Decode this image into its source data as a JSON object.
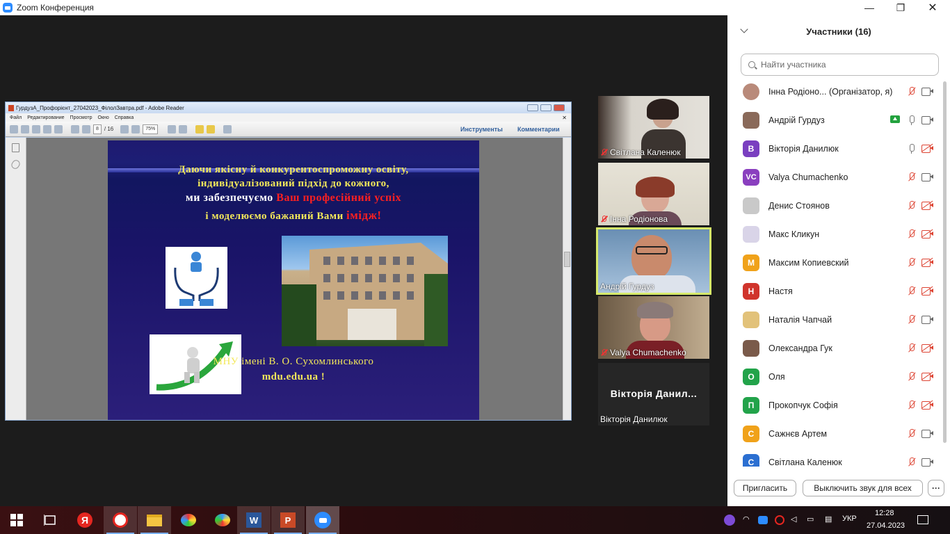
{
  "window": {
    "title": "Zoom Конференция"
  },
  "reader": {
    "title": "ГурдузА_Профорієнт_27042023_ФілолЗавтра.pdf - Adobe Reader",
    "menu": [
      "Файл",
      "Редактирование",
      "Просмотр",
      "Окно",
      "Справка"
    ],
    "page_current": "8",
    "page_total": "/ 16",
    "zoom": "75%",
    "tools_label": "Инструменты",
    "comments_label": "Комментарии"
  },
  "slide": {
    "line1": "Даючи якісну й конкурентоспроможну освіту,",
    "line2": "індивідуалізований підхід до кожного,",
    "line3_a": "ми забезпечуємо ",
    "line3_b": "Ваш професійний успіх",
    "line4_a": "і моделюємо бажаний Вами ",
    "line4_b": "імідж!",
    "university": "МНУ імені В. О. Сухомлинського",
    "site": "mdu.edu.ua !"
  },
  "videos": [
    {
      "name": "Світлана Каленюк",
      "muted": true
    },
    {
      "name": "Інна Родіонова",
      "muted": true
    },
    {
      "name": "Андрій Гурдуз",
      "muted": false
    },
    {
      "name": "Valya Chumachenko",
      "muted": true
    },
    {
      "name": "Вікторія Данилюк",
      "muted": false,
      "big_name": "Вікторія Данил..."
    }
  ],
  "participants": {
    "header": "Участники (16)",
    "search_placeholder": "Найти участника",
    "list": [
      {
        "name": "Інна Родіоно...  (Організатор, я)",
        "avatar": "photo",
        "color": "#b98a7a",
        "mic": "off",
        "cam": "on"
      },
      {
        "name": "Андрій Гурдуз",
        "avatar": "photo",
        "color": "#8a6a5a",
        "mic": "on",
        "cam": "on",
        "sharing": true
      },
      {
        "name": "Вікторія Данилюк",
        "avatar": "В",
        "color": "#7a3fc0",
        "mic": "on",
        "cam": "off"
      },
      {
        "name": "Valya Chumachenko",
        "avatar": "VC",
        "color": "#8a3fbf",
        "mic": "off",
        "cam": "on"
      },
      {
        "name": "Денис Стоянов",
        "avatar": "photo",
        "color": "#c9c9c9",
        "mic": "off",
        "cam": "off"
      },
      {
        "name": "Макс Кликун",
        "avatar": "photo",
        "color": "#d9d4e8",
        "mic": "off",
        "cam": "off"
      },
      {
        "name": "Максим Копиевский",
        "avatar": "М",
        "color": "#f0a21a",
        "mic": "off",
        "cam": "off"
      },
      {
        "name": "Настя",
        "avatar": "Н",
        "color": "#d0342c",
        "mic": "off",
        "cam": "off"
      },
      {
        "name": "Наталія Чапчай",
        "avatar": "photo",
        "color": "#e2c27a",
        "mic": "off",
        "cam": "on"
      },
      {
        "name": "Олександра Гук",
        "avatar": "photo",
        "color": "#7a5a4a",
        "mic": "off",
        "cam": "off"
      },
      {
        "name": "Оля",
        "avatar": "О",
        "color": "#22a34a",
        "mic": "off",
        "cam": "off"
      },
      {
        "name": "Прокопчук Софія",
        "avatar": "П",
        "color": "#22a34a",
        "mic": "off",
        "cam": "off"
      },
      {
        "name": "Сажнєв Артем",
        "avatar": "С",
        "color": "#f0a21a",
        "mic": "off",
        "cam": "on"
      },
      {
        "name": "Світлана Каленюк",
        "avatar": "С",
        "color": "#2b6fd1",
        "mic": "off",
        "cam": "on"
      }
    ],
    "invite_label": "Пригласить",
    "mute_all_label": "Выключить звук для всех",
    "more_label": "···"
  },
  "taskbar": {
    "lang": "УКР",
    "time": "12:28",
    "date": "27.04.2023",
    "yandex_letter": "Я"
  }
}
